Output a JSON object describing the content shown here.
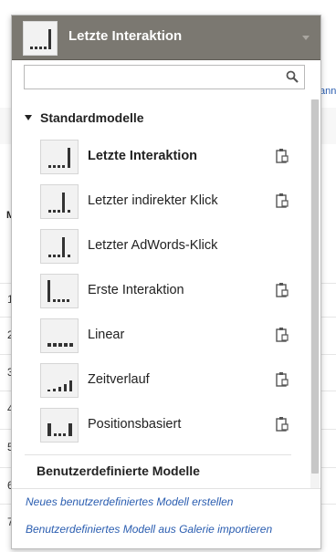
{
  "background": {
    "partial_link": "ann",
    "partial_header": "M",
    "row_numbers": [
      "1",
      "2",
      "3",
      "4",
      "5",
      "6",
      "7"
    ]
  },
  "dropdown": {
    "selected_title": "Letzte Interaktion",
    "search": {
      "value": "",
      "placeholder": ""
    },
    "section_standard": "Standardmodelle",
    "models": [
      {
        "label": "Letzte Interaktion",
        "icon": "last-interaction-icon",
        "bold": true,
        "copy": true
      },
      {
        "label": "Letzter indirekter Klick",
        "icon": "last-indirect-click-icon",
        "bold": false,
        "copy": true
      },
      {
        "label": "Letzter AdWords-Klick",
        "icon": "last-adwords-click-icon",
        "bold": false,
        "copy": false
      },
      {
        "label": "Erste Interaktion",
        "icon": "first-interaction-icon",
        "bold": false,
        "copy": true
      },
      {
        "label": "Linear",
        "icon": "linear-icon",
        "bold": false,
        "copy": true
      },
      {
        "label": "Zeitverlauf",
        "icon": "time-decay-icon",
        "bold": false,
        "copy": true
      },
      {
        "label": "Positionsbasiert",
        "icon": "position-based-icon",
        "bold": false,
        "copy": true
      }
    ],
    "section_custom": "Benutzerdefinierte Modelle",
    "actions": {
      "create": "Neues benutzerdefiniertes Modell erstellen",
      "import": "Benutzerdefiniertes Modell aus Galerie importieren"
    },
    "colors": {
      "header_bg": "#7b7871",
      "link": "#2a5db0",
      "bar": "#333333"
    }
  }
}
